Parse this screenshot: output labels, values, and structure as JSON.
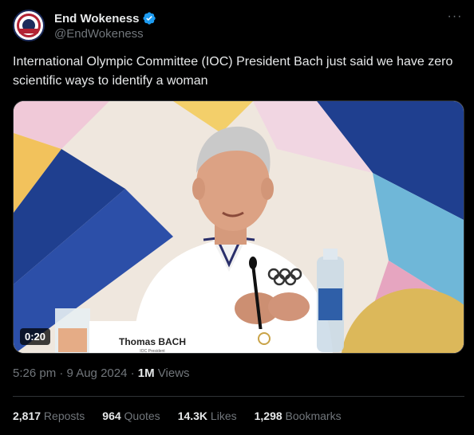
{
  "author": {
    "display_name": "End Wokeness",
    "handle": "@EndWokeness",
    "avatar_icon": "patriotic-badge-avatar",
    "verified_icon": "verified-badge-icon",
    "verified_color": "#1d9bf0"
  },
  "tweet": {
    "text": "International Olympic Committee (IOC) President Bach just said we have zero scientific ways to identify a woman",
    "video_duration": "0:20",
    "name_placard": "Thomas BACH",
    "placard_subtitle": "IOC President",
    "timestamp": "5:26 pm · 9 Aug 2024 · ",
    "views_count": "1M",
    "views_label": " Views"
  },
  "stats": [
    {
      "count": "2,817",
      "label": " Reposts"
    },
    {
      "count": "964",
      "label": " Quotes"
    },
    {
      "count": "14.3K",
      "label": " Likes"
    },
    {
      "count": "1,298",
      "label": " Bookmarks"
    }
  ],
  "colors": {
    "background": "#000000",
    "text": "#e7e9ea",
    "secondary_text": "#71767b",
    "divider": "#2f3336"
  }
}
